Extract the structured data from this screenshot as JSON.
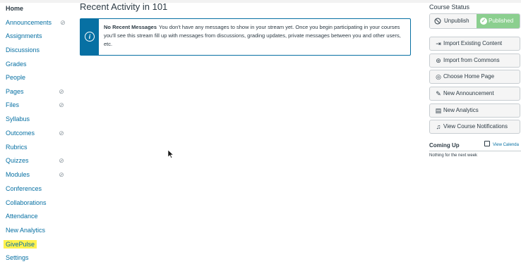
{
  "course_nav": {
    "items": [
      {
        "label": "Home",
        "active": true,
        "hidden": false
      },
      {
        "label": "Announcements",
        "active": false,
        "hidden": true
      },
      {
        "label": "Assignments",
        "active": false,
        "hidden": false
      },
      {
        "label": "Discussions",
        "active": false,
        "hidden": false
      },
      {
        "label": "Grades",
        "active": false,
        "hidden": false
      },
      {
        "label": "People",
        "active": false,
        "hidden": false
      },
      {
        "label": "Pages",
        "active": false,
        "hidden": true
      },
      {
        "label": "Files",
        "active": false,
        "hidden": true
      },
      {
        "label": "Syllabus",
        "active": false,
        "hidden": false
      },
      {
        "label": "Outcomes",
        "active": false,
        "hidden": true
      },
      {
        "label": "Rubrics",
        "active": false,
        "hidden": false
      },
      {
        "label": "Quizzes",
        "active": false,
        "hidden": true
      },
      {
        "label": "Modules",
        "active": false,
        "hidden": true
      },
      {
        "label": "Conferences",
        "active": false,
        "hidden": false
      },
      {
        "label": "Collaborations",
        "active": false,
        "hidden": false
      },
      {
        "label": "Attendance",
        "active": false,
        "hidden": false
      },
      {
        "label": "New Analytics",
        "active": false,
        "hidden": false
      },
      {
        "label": "GivePulse",
        "active": false,
        "hidden": false,
        "highlighted": true
      },
      {
        "label": "Settings",
        "active": false,
        "hidden": false
      }
    ],
    "hidden_icon": "eye-slash-icon"
  },
  "main": {
    "title": "Recent Activity in 101",
    "notice": {
      "title": "No Recent Messages",
      "body": "You don't have any messages to show in your stream yet. Once you begin participating in your courses you'll see this stream fill up with messages from discussions, grading updates, private messages between you and other users, etc.",
      "icon": "info-icon"
    }
  },
  "sidebar": {
    "status_heading": "Course Status",
    "unpublish_label": "Unpublish",
    "published_label": "Published",
    "buttons": [
      {
        "label": "Import Existing Content",
        "icon": "import-icon"
      },
      {
        "label": "Import from Commons",
        "icon": "commons-icon"
      },
      {
        "label": "Choose Home Page",
        "icon": "target-icon"
      },
      {
        "label": "New Announcement",
        "icon": "megaphone-icon"
      },
      {
        "label": "New Analytics",
        "icon": "analytics-icon"
      },
      {
        "label": "View Course Notifications",
        "icon": "bell-icon"
      }
    ],
    "coming_up": {
      "heading": "Coming Up",
      "calendar_link": "View Calenda",
      "empty_text": "Nothing for the next week"
    }
  },
  "colors": {
    "link": "#0770a3",
    "text": "#2d3b45",
    "published": "#8bcf8f",
    "highlight": "#fff24d"
  }
}
